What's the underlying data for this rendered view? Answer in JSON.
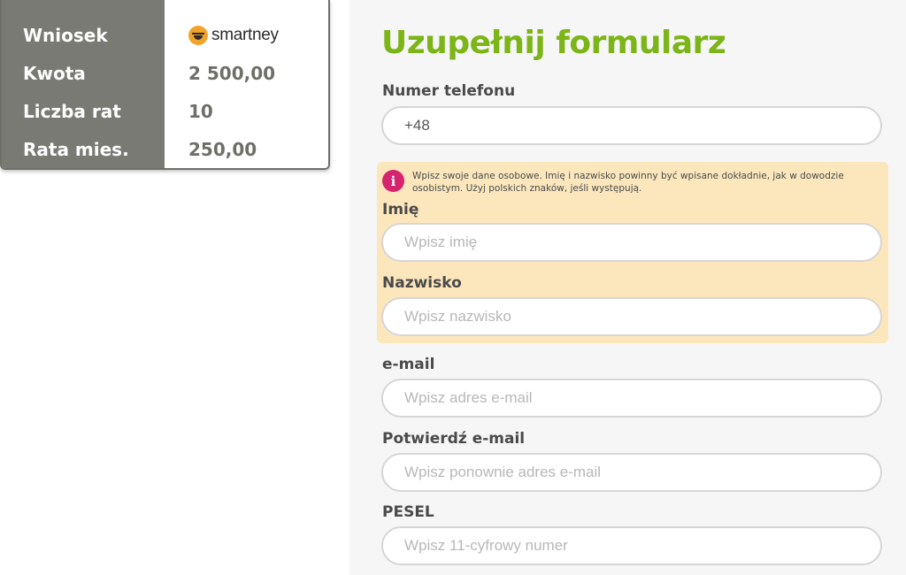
{
  "summary": {
    "rows": [
      {
        "label": "Wniosek",
        "value": ""
      },
      {
        "label": "Kwota",
        "value": "2 500,00"
      },
      {
        "label": "Liczba rat",
        "value": "10"
      },
      {
        "label": "Rata mies.",
        "value": "250,00"
      }
    ],
    "logo": {
      "text": "smartney",
      "icon": "smiley-logo-icon",
      "color": "#f2a32a"
    }
  },
  "form": {
    "title": "Uzupełnij formularz",
    "title_color": "#7cb518",
    "phone": {
      "label": "Numer telefonu",
      "value": "+48"
    },
    "info": {
      "icon": "info-icon",
      "text": "Wpisz swoje dane osobowe. Imię i nazwisko powinny być wpisane dokładnie, jak w dowodzie osobistym. Użyj polskich znaków, jeśli występują."
    },
    "first_name": {
      "label": "Imię",
      "placeholder": "Wpisz imię"
    },
    "last_name": {
      "label": "Nazwisko",
      "placeholder": "Wpisz nazwisko"
    },
    "email": {
      "label": "e-mail",
      "placeholder": "Wpisz adres e-mail"
    },
    "email_confirm": {
      "label": "Potwierdź e-mail",
      "placeholder": "Wpisz ponownie adres e-mail"
    },
    "pesel": {
      "label": "PESEL",
      "placeholder": "Wpisz 11-cyfrowy numer"
    }
  }
}
